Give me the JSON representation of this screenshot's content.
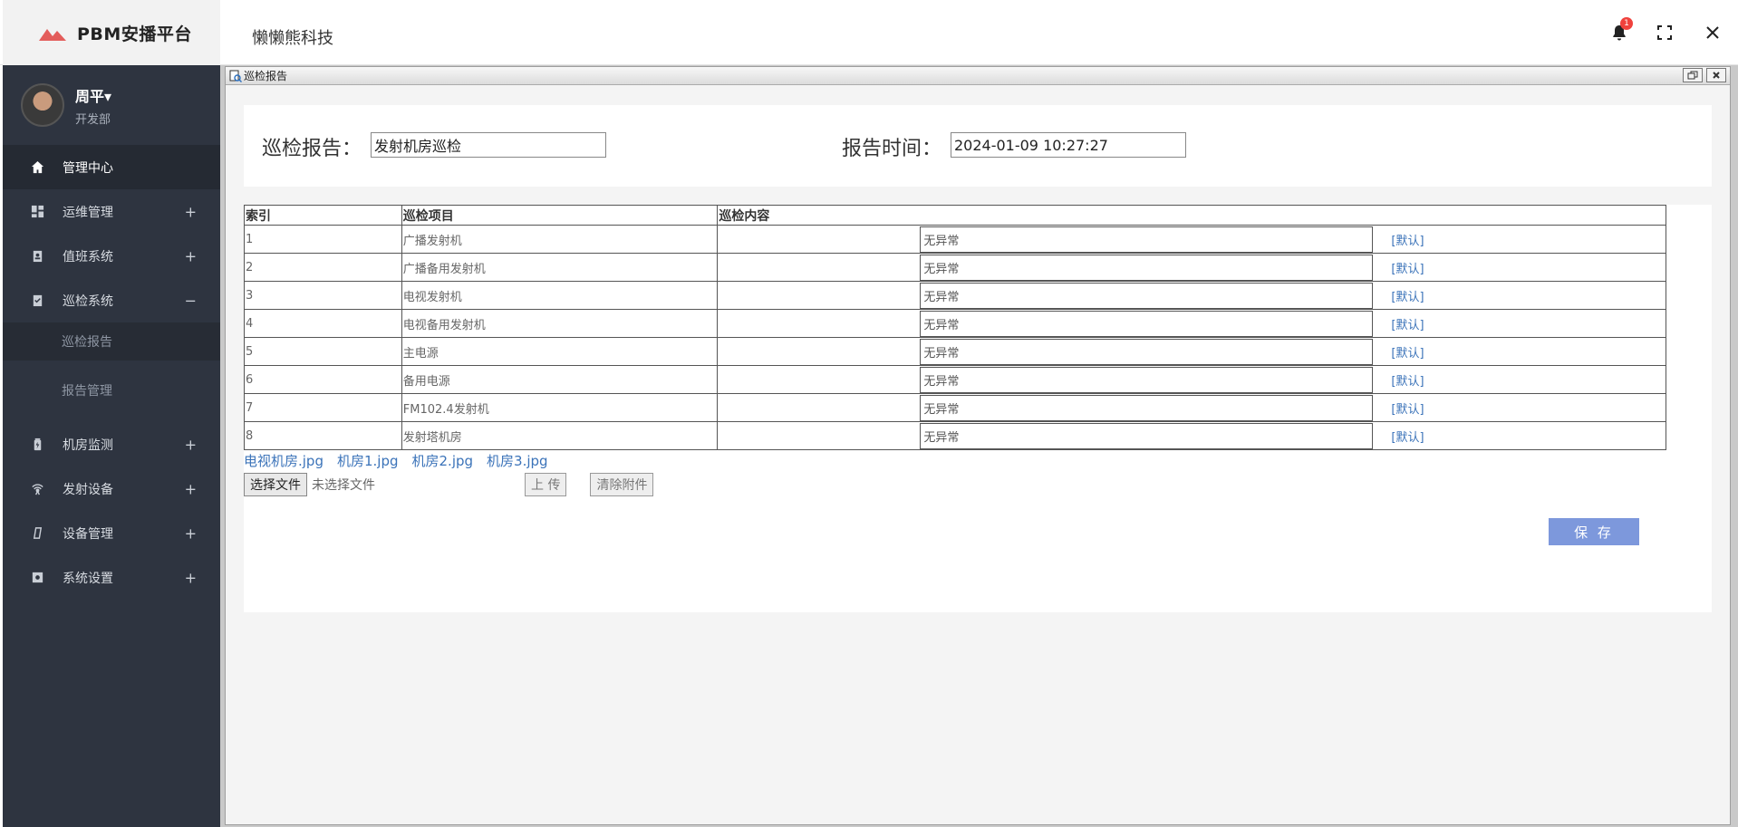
{
  "brand": {
    "name": "PBM安播平台"
  },
  "header": {
    "company": "懒懒熊科技",
    "notification_count": "1"
  },
  "user": {
    "name": "周平▾",
    "dept": "开发部"
  },
  "sidebar": {
    "items": [
      {
        "label": "管理中心",
        "sign": ""
      },
      {
        "label": "运维管理",
        "sign": "+"
      },
      {
        "label": "值班系统",
        "sign": "+"
      },
      {
        "label": "巡检系统",
        "sign": "−"
      },
      {
        "label": "机房监测",
        "sign": "+"
      },
      {
        "label": "发射设备",
        "sign": "+"
      },
      {
        "label": "设备管理",
        "sign": "+"
      },
      {
        "label": "系统设置",
        "sign": "+"
      }
    ],
    "sub_items": [
      "巡检报告",
      "报告管理"
    ]
  },
  "window": {
    "title": "巡检报告"
  },
  "form": {
    "report_label": "巡检报告：",
    "report_value": "发射机房巡检",
    "time_label": "报告时间：",
    "time_value": "2024-01-09 10:27:27"
  },
  "table": {
    "headers": [
      "索引",
      "巡检项目",
      "巡检内容"
    ],
    "rows": [
      {
        "index": "1",
        "item": "广播发射机",
        "content": "无异常",
        "link": "[默认]"
      },
      {
        "index": "2",
        "item": "广播备用发射机",
        "content": "无异常",
        "link": "[默认]"
      },
      {
        "index": "3",
        "item": "电视发射机",
        "content": "无异常",
        "link": "[默认]"
      },
      {
        "index": "4",
        "item": "电视备用发射机",
        "content": "无异常",
        "link": "[默认]"
      },
      {
        "index": "5",
        "item": "主电源",
        "content": "无异常",
        "link": "[默认]"
      },
      {
        "index": "6",
        "item": "备用电源",
        "content": "无异常",
        "link": "[默认]"
      },
      {
        "index": "7",
        "item": "FM102.4发射机",
        "content": "无异常",
        "link": "[默认]"
      },
      {
        "index": "8",
        "item": "发射塔机房",
        "content": "无异常",
        "link": "[默认]"
      }
    ]
  },
  "attachments": [
    "电视机房.jpg",
    "机房1.jpg",
    "机房2.jpg",
    "机房3.jpg"
  ],
  "upload": {
    "choose_label": "选择文件",
    "no_file_text": "未选择文件",
    "upload_label": "上 传",
    "clear_label": "清除附件"
  },
  "save_label": "保 存",
  "colors": {
    "sidebar_bg": "#2e3440",
    "accent": "#7d98dc",
    "link": "#3b73b9",
    "badge": "#f0413c"
  }
}
